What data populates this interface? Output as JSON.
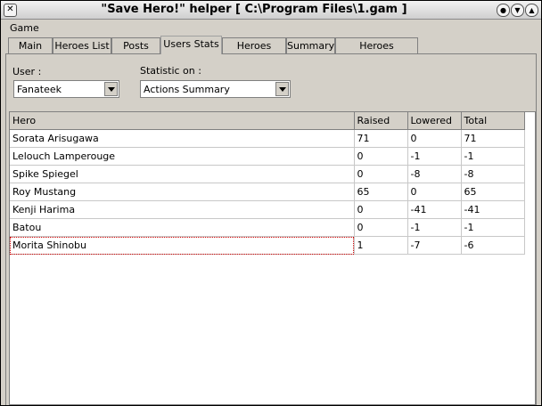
{
  "window": {
    "title": "\"Save Hero!\" helper [ C:\\Program Files\\1.gam ]"
  },
  "menu": [
    "Game"
  ],
  "tabs": [
    "Main",
    "Heroes List",
    "Posts",
    "Users Stats",
    "Heroes Stats",
    "Summary",
    "Heroes Summary"
  ],
  "active_tab": "Users Stats",
  "filters": {
    "user_label": "User :",
    "user_value": "Fanateek",
    "stat_label": "Statistic on :",
    "stat_value": "Actions Summary"
  },
  "table": {
    "columns": [
      "Hero",
      "Raised",
      "Lowered",
      "Total"
    ],
    "rows": [
      [
        "Sorata Arisugawa",
        "71",
        "0",
        "71"
      ],
      [
        "Lelouch Lamperouge",
        "0",
        "-1",
        "-1"
      ],
      [
        "Spike Spiegel",
        "0",
        "-8",
        "-8"
      ],
      [
        "Roy Mustang",
        "65",
        "0",
        "65"
      ],
      [
        "Kenji Harima",
        "0",
        "-41",
        "-41"
      ],
      [
        "Batou",
        "0",
        "-1",
        "-1"
      ],
      [
        "Morita Shinobu",
        "1",
        "-7",
        "-6"
      ]
    ]
  }
}
